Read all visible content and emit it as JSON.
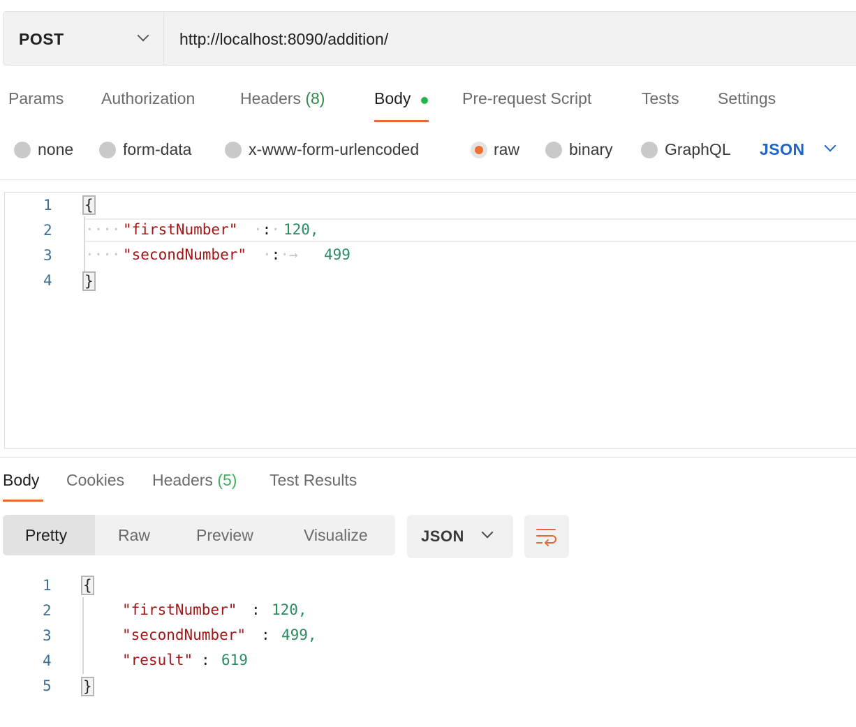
{
  "request": {
    "method": "POST",
    "url": "http://localhost:8090/addition/",
    "tabs": [
      {
        "label": "Params"
      },
      {
        "label": "Authorization"
      },
      {
        "label": "Headers ",
        "count": "(8)"
      },
      {
        "label": "Body",
        "active": true,
        "indicator": "green-dot"
      },
      {
        "label": "Pre-request Script"
      },
      {
        "label": "Tests"
      },
      {
        "label": "Settings"
      }
    ],
    "body_types": [
      "none",
      "form-data",
      "x-www-form-urlencoded",
      "raw",
      "binary",
      "GraphQL"
    ],
    "selected_body_type": "raw",
    "language": "JSON",
    "editor": {
      "line_numbers": [
        "1",
        "2",
        "3",
        "4"
      ],
      "open_brace": "{",
      "close_brace": "}",
      "key1": "\"firstNumber\"",
      "val1": "120,",
      "key2": "\"secondNumber\"",
      "val2": "499"
    }
  },
  "response": {
    "tabs": [
      {
        "label": "Body",
        "active": true
      },
      {
        "label": "Cookies"
      },
      {
        "label": "Headers ",
        "count": "(5)"
      },
      {
        "label": "Test Results"
      }
    ],
    "view_modes": [
      "Pretty",
      "Raw",
      "Preview",
      "Visualize"
    ],
    "active_view": "Pretty",
    "format": "JSON",
    "wrap_icon": "wrap-lines-icon",
    "body": {
      "line_numbers": [
        "1",
        "2",
        "3",
        "4",
        "5"
      ],
      "open_brace": "{",
      "close_brace": "}",
      "lines": [
        {
          "key": "\"firstNumber\"",
          "value": "120,"
        },
        {
          "key": "\"secondNumber\"",
          "value": "499,"
        },
        {
          "key": "\"result\"",
          "value": "619"
        }
      ]
    }
  },
  "colors": {
    "accent": "#e8692f",
    "link": "#1d64c8",
    "string_key": "#a31515",
    "number": "#2b8c61"
  }
}
